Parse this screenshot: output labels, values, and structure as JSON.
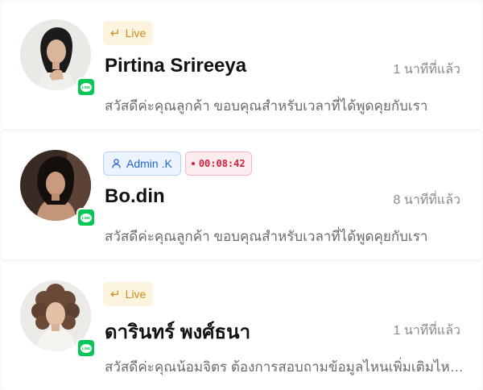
{
  "conversations": [
    {
      "tag_live": "Live",
      "name": "Pirtina Srireeya",
      "time": "1 นาทีที่แล้ว",
      "preview": "สวัสดีค่ะคุณลูกค้า ขอบคุณสำหรับเวลาที่ได้พูดคุยกับเรา",
      "channel_badge": "LINE"
    },
    {
      "tag_admin": "Admin .K",
      "tag_timer": "00:08:42",
      "name": "Bo.din",
      "time": "8 นาทีที่แล้ว",
      "preview": "สวัสดีค่ะคุณลูกค้า ขอบคุณสำหรับเวลาที่ได้พูดคุยกับเรา",
      "channel_badge": "LINE"
    },
    {
      "tag_live": "Live",
      "name": "ดารินทร์ พงศ์ธนา",
      "time": "1 นาทีที่แล้ว",
      "preview": "สวัสดีค่ะคุณน้อมจิตร ต้องการสอบถามข้อมูลไหนเพิ่มเติมไหมคะ",
      "channel_badge": "LINE"
    }
  ],
  "colors": {
    "line_green": "#06c755",
    "live_bg": "#fdf4df",
    "live_text": "#d08a1f",
    "admin_bg": "#eaf3ff",
    "admin_text": "#2364d8",
    "timer_bg": "#fdecef",
    "timer_text": "#d61f3a"
  },
  "icons": {
    "live": "reply-arrow-icon",
    "admin": "user-icon",
    "timer": "dot-icon",
    "channel": "line-app-icon"
  }
}
